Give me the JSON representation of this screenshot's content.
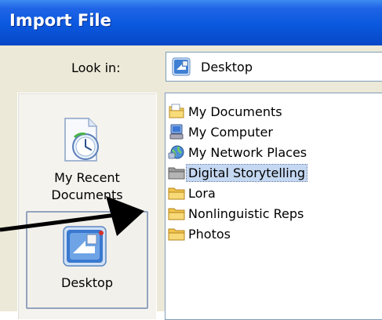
{
  "window": {
    "title": "Import File"
  },
  "lookin": {
    "label": "Look in:",
    "value": "Desktop",
    "icon": "desktop-icon"
  },
  "places": [
    {
      "label_line1": "My Recent",
      "label_line2": "Documents",
      "icon": "recent-documents-icon"
    },
    {
      "label": "Desktop",
      "icon": "desktop-icon",
      "selected": true
    }
  ],
  "files": [
    {
      "name": "My Documents",
      "icon": "my-documents-icon"
    },
    {
      "name": "My Computer",
      "icon": "my-computer-icon"
    },
    {
      "name": "My Network Places",
      "icon": "network-places-icon"
    },
    {
      "name": "Digital Storytelling",
      "icon": "folder-icon",
      "selected": true
    },
    {
      "name": "Lora",
      "icon": "folder-icon"
    },
    {
      "name": "Nonlinguistic Reps",
      "icon": "folder-icon"
    },
    {
      "name": "Photos",
      "icon": "folder-icon"
    }
  ],
  "colors": {
    "titlebar": "#0a58de",
    "dialog_bg": "#ece9d8",
    "selection": "#c5d8f2",
    "folder": "#f5d36b"
  }
}
